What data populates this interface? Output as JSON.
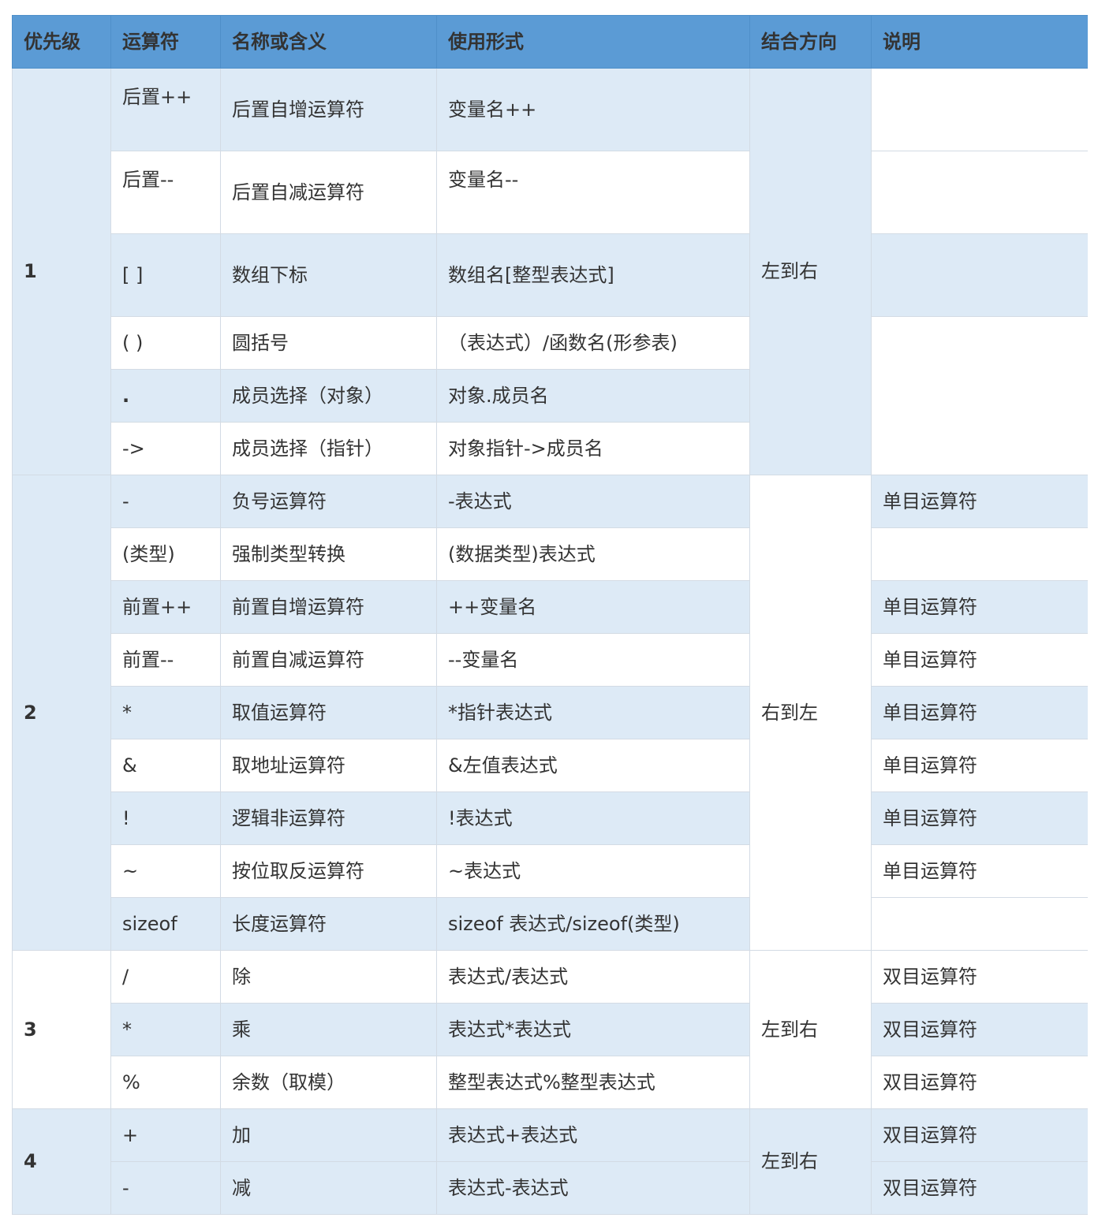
{
  "headers": [
    "优先级",
    "运算符",
    "名称或含义",
    "使用形式",
    "结合方向",
    "说明"
  ],
  "groups": [
    {
      "level": "1",
      "direction": "左到右",
      "rows": [
        {
          "op": "后置++",
          "name": "后置自增运算符",
          "usage": "变量名++",
          "note": ""
        },
        {
          "op": "后置--",
          "name": "后置自减运算符",
          "usage": "变量名--",
          "note": ""
        },
        {
          "op": "[ ]",
          "name": "数组下标",
          "usage": "数组名[整型表达式]",
          "note": ""
        },
        {
          "op": "( )",
          "name": "圆括号",
          "usage": "（表达式）/函数名(形参表)",
          "note": ""
        },
        {
          "op": ".",
          "name": "成员选择（对象）",
          "usage": "对象.成员名",
          "note": ""
        },
        {
          "op": "->",
          "name": "成员选择（指针）",
          "usage": "对象指针->成员名",
          "note": ""
        }
      ]
    },
    {
      "level": "2",
      "direction": "右到左",
      "rows": [
        {
          "op": "-",
          "name": "负号运算符",
          "usage": "-表达式",
          "note": "单目运算符"
        },
        {
          "op": "(类型)",
          "name": "强制类型转换",
          "usage": "(数据类型)表达式",
          "note": ""
        },
        {
          "op": "前置++",
          "name": "前置自增运算符",
          "usage": "++变量名",
          "note": "单目运算符"
        },
        {
          "op": "前置--",
          "name": "前置自减运算符",
          "usage": "--变量名",
          "note": "单目运算符"
        },
        {
          "op": "*",
          "name": "取值运算符",
          "usage": "*指针表达式",
          "note": "单目运算符"
        },
        {
          "op": "&",
          "name": "取地址运算符",
          "usage": "&左值表达式",
          "note": "单目运算符"
        },
        {
          "op": "!",
          "name": "逻辑非运算符",
          "usage": "!表达式",
          "note": "单目运算符"
        },
        {
          "op": "~",
          "name": "按位取反运算符",
          "usage": "~表达式",
          "note": "单目运算符"
        },
        {
          "op": "sizeof",
          "name": "长度运算符",
          "usage": "sizeof 表达式/sizeof(类型)",
          "note": ""
        }
      ]
    },
    {
      "level": "3",
      "direction": "左到右",
      "rows": [
        {
          "op": "/",
          "name": "除",
          "usage": "表达式/表达式",
          "note": "双目运算符"
        },
        {
          "op": "*",
          "name": "乘",
          "usage": "表达式*表达式",
          "note": "双目运算符"
        },
        {
          "op": "%",
          "name": "余数（取模）",
          "usage": "整型表达式%整型表达式",
          "note": "双目运算符"
        }
      ]
    },
    {
      "level": "4",
      "direction": "左到右",
      "rows": [
        {
          "op": "+",
          "name": "加",
          "usage": "表达式+表达式",
          "note": "双目运算符"
        },
        {
          "op": "-",
          "name": "减",
          "usage": "表达式-表达式",
          "note": "双目运算符"
        }
      ]
    }
  ],
  "colors": {
    "header_bg": "#5b9bd5",
    "band": "#ddeaf6",
    "white": "#ffffff",
    "border": "#d3dbe4"
  }
}
